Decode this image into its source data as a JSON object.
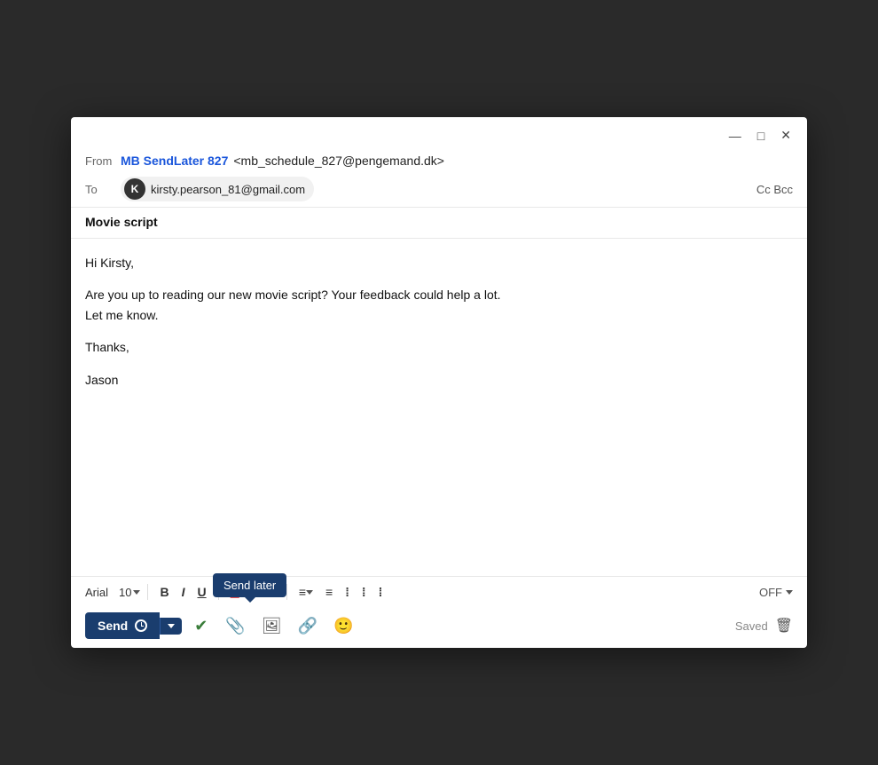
{
  "window": {
    "title_bar": {
      "minimize_label": "—",
      "maximize_label": "□",
      "close_label": "✕"
    },
    "header": {
      "from_label": "From",
      "from_name": "MB SendLater 827",
      "from_email": "<mb_schedule_827@pengemand.dk>",
      "to_label": "To",
      "to_recipient_avatar": "K",
      "to_recipient_email": "kirsty.pearson_81@gmail.com",
      "cc_bcc_label": "Cc Bcc"
    },
    "subject": "Movie script",
    "body_lines": [
      "Hi Kirsty,",
      "",
      "Are you up to reading our new movie script? Your feedback could help a lot.",
      "Let me know.",
      "",
      "Thanks,",
      "",
      "Jason"
    ],
    "toolbar": {
      "font_name": "Arial",
      "font_size": "10",
      "bold_label": "B",
      "italic_label": "I",
      "underline_label": "U",
      "off_label": "OFF",
      "saved_label": "Saved"
    },
    "send_button": {
      "label": "Send"
    },
    "tooltip": {
      "label": "Send later"
    },
    "actions": {
      "attachment": "📎",
      "image": "🖼",
      "link": "🔗",
      "emoji": "🙂",
      "delete": "🗑"
    }
  }
}
